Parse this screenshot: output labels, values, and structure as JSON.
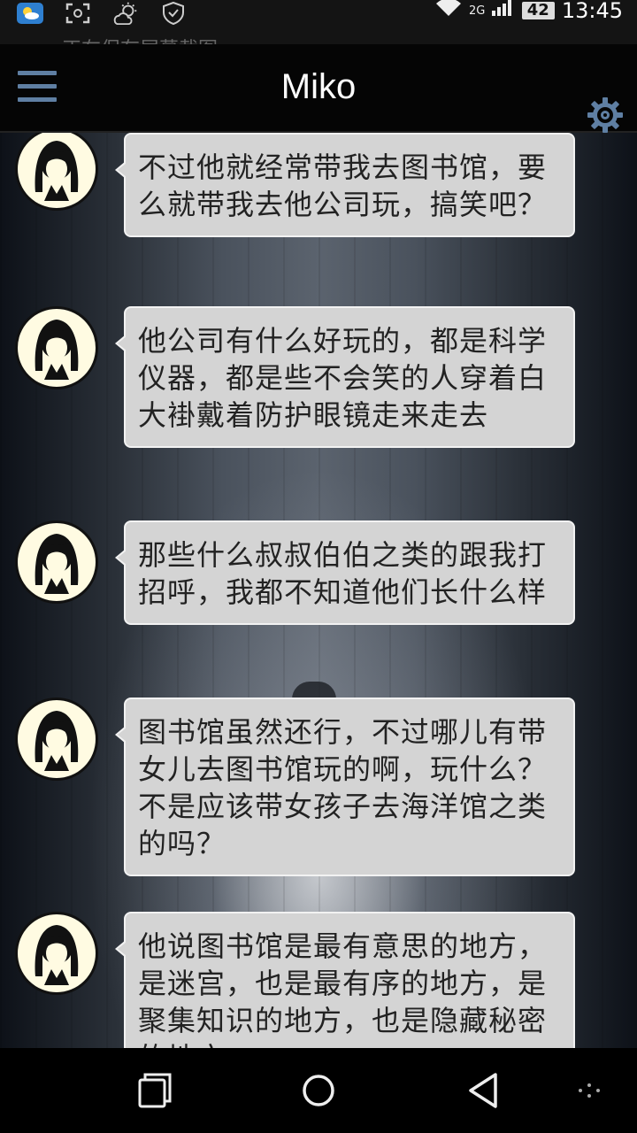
{
  "status_bar": {
    "icons": [
      "weather-app-icon",
      "screenshot-icon",
      "weather-sun-icon",
      "shield-icon"
    ],
    "signal_icons": [
      "wifi-icon",
      "signal-icon"
    ],
    "battery": "42",
    "time": "13:45",
    "ghost_notice": "正在保存屏幕截图…"
  },
  "app_bar": {
    "title": "Miko",
    "menu_icon": "menu-icon",
    "settings_icon": "gear-icon"
  },
  "messages": [
    {
      "sender": "Miko",
      "text": "不过他就经常带我去图书馆，要么就带我去他公司玩，搞笑吧？"
    },
    {
      "sender": "Miko",
      "text": "他公司有什么好玩的，都是科学仪器，都是些不会笑的人穿着白大褂戴着防护眼镜走来走去"
    },
    {
      "sender": "Miko",
      "text": "那些什么叔叔伯伯之类的跟我打招呼，我都不知道他们长什么样"
    },
    {
      "sender": "Miko",
      "text": "图书馆虽然还行，不过哪儿有带女儿去图书馆玩的啊，玩什么？不是应该带女孩子去海洋馆之类的吗？"
    },
    {
      "sender": "Miko",
      "text": "他说图书馆是最有意思的地方，是迷宫，也是最有序的地方，是聚集知识的地方，也是隐藏秘密的地方"
    }
  ],
  "nav_bar": {
    "icons": [
      "recent-apps-icon",
      "home-icon",
      "back-icon",
      "more-icon"
    ]
  },
  "colors": {
    "accent": "#5f7fa3",
    "bubble": "#d4d4d4",
    "bar": "#050505"
  }
}
